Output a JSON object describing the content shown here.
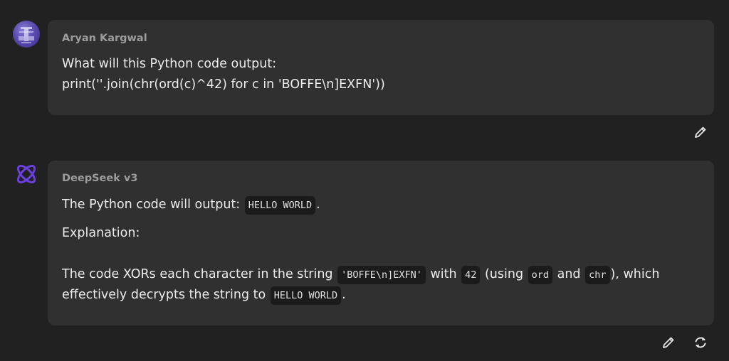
{
  "messages": [
    {
      "role": "user",
      "author": "Aryan Kargwal",
      "lines": [
        "What will this Python code output:",
        "print(''.join(chr(ord(c)^42) for c in 'BOFFE\\n]EXFN'))"
      ],
      "actions": [
        "edit-icon"
      ]
    },
    {
      "role": "assistant",
      "author": "DeepSeek v3",
      "answer_prefix": "The Python code will output: ",
      "answer_code": "HELLO WORLD",
      "answer_suffix": ".",
      "explanation_heading": "Explanation:",
      "expl_1": "The code XORs each character in the string ",
      "expl_code_1": "'BOFFE\\n]EXFN'",
      "expl_2": " with ",
      "expl_code_2": "42",
      "expl_3": " (using ",
      "expl_code_3": "ord",
      "expl_4": " and ",
      "expl_code_4": "chr",
      "expl_5": "), which",
      "expl_6": "effectively decrypts the string to ",
      "expl_code_5": "HELLO WORLD",
      "expl_7": ".",
      "actions": [
        "edit-icon",
        "regenerate-icon"
      ]
    }
  ],
  "colors": {
    "background": "#212121",
    "bubble": "#303030",
    "code_bg": "#1b1b1b",
    "bot_icon": "#6b3fe0"
  }
}
